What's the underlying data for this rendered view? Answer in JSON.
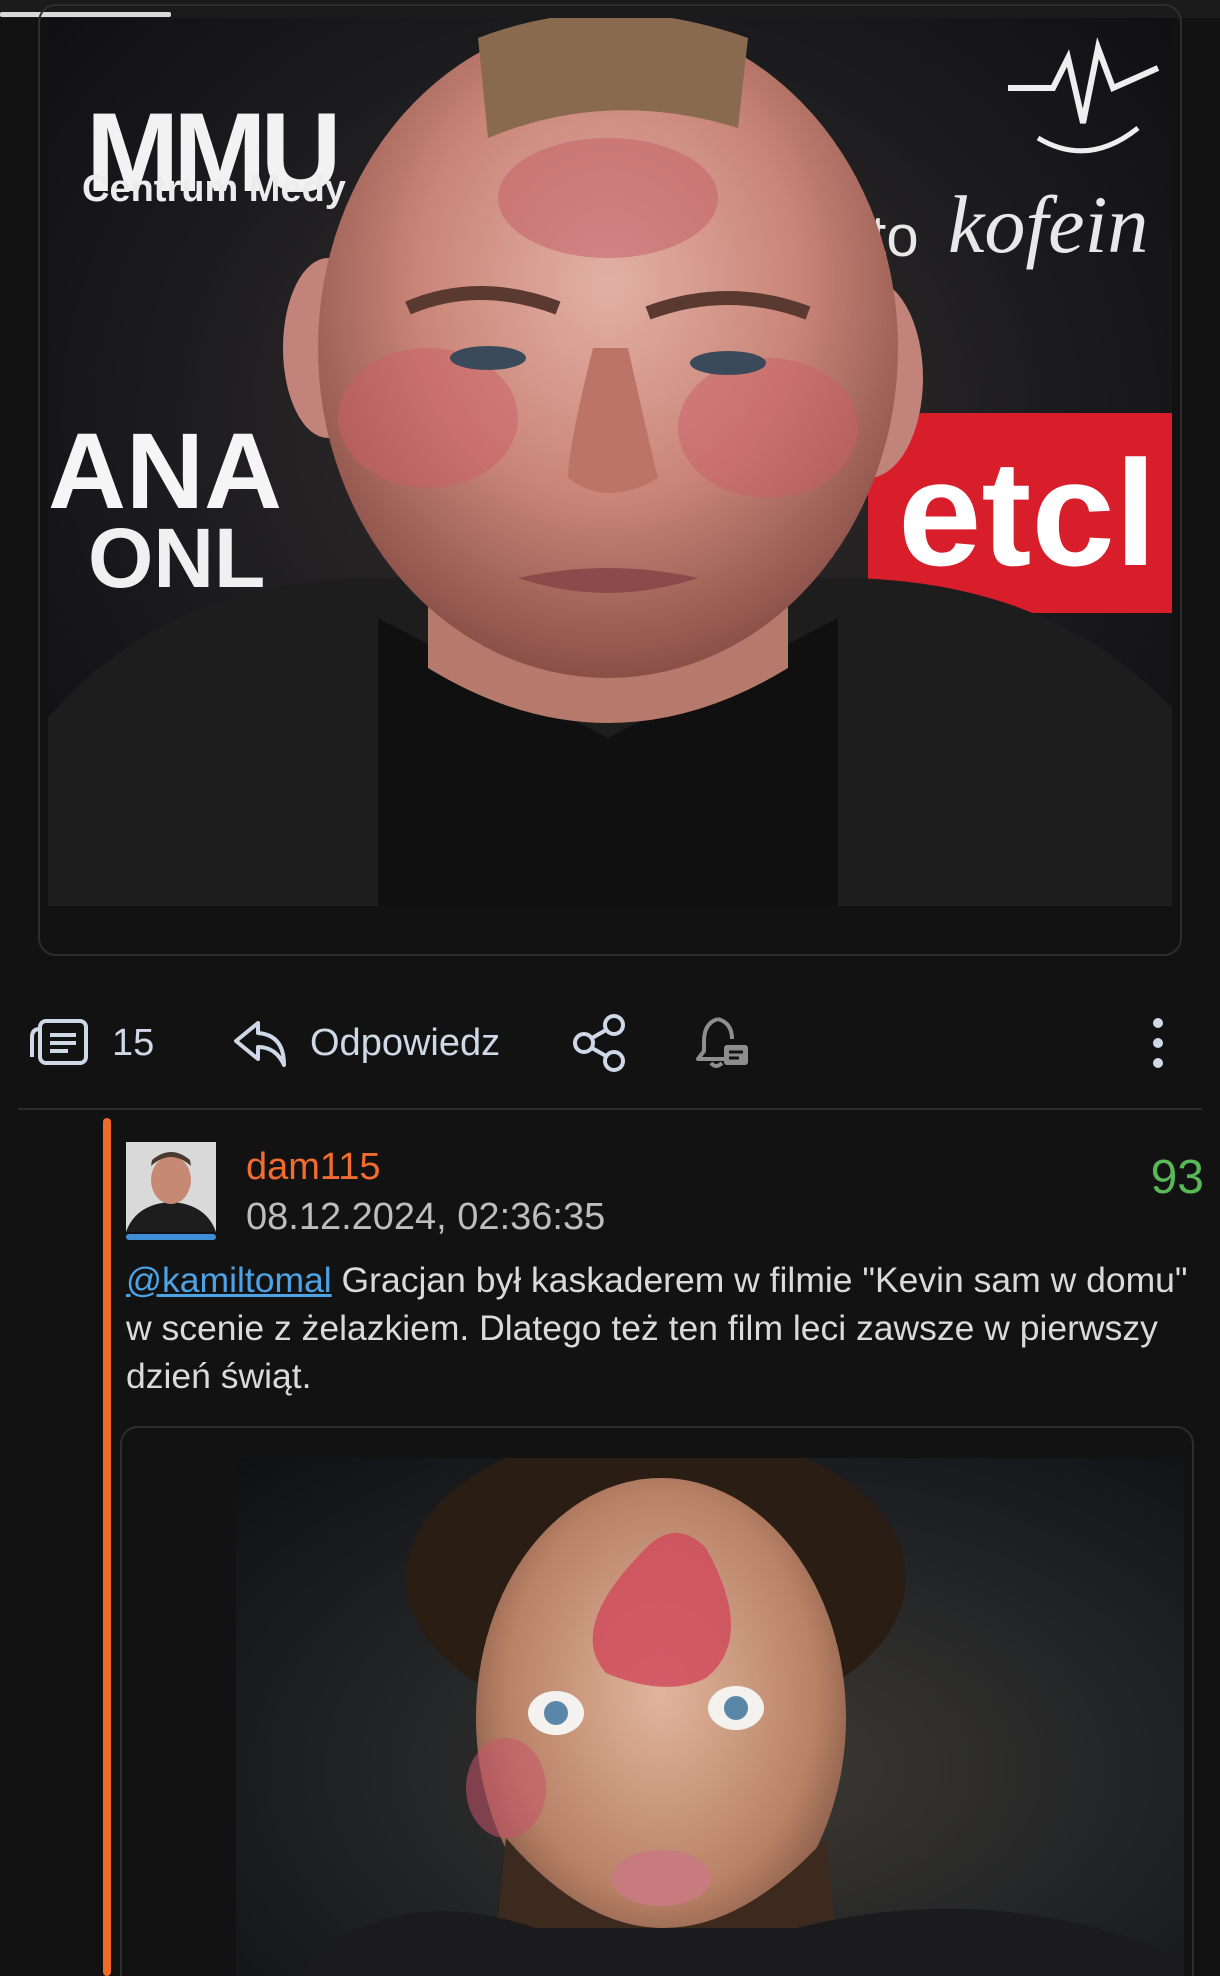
{
  "post": {
    "media_image_alt": "",
    "sponsor_texts": {
      "mmu": "MMU",
      "centrum": "Centrum Medy",
      "ana": "ANA",
      "onl": "ONL",
      "auto": "uto",
      "kofein": "kofein",
      "etc": "etcl"
    },
    "actions": {
      "comments_count": "15",
      "reply_label": "Odpowiedz"
    }
  },
  "reply": {
    "username": "dam115",
    "timestamp": "08.12.2024, 02:36:35",
    "score": "93",
    "mention": "@kamiltomal",
    "text": " Gracjan był kaskaderem w filmie \"Kevin sam w domu\" w scenie z żelazkiem. Dlatego też ten film leci zawsze w pierwszy dzień świąt."
  },
  "colors": {
    "background": "#121212",
    "username": "#f26b2f",
    "score": "#58b858",
    "mention": "#4ea3e6",
    "thread_line": "#f06a2a"
  },
  "progress": {
    "loaded_fraction": 0.14
  }
}
